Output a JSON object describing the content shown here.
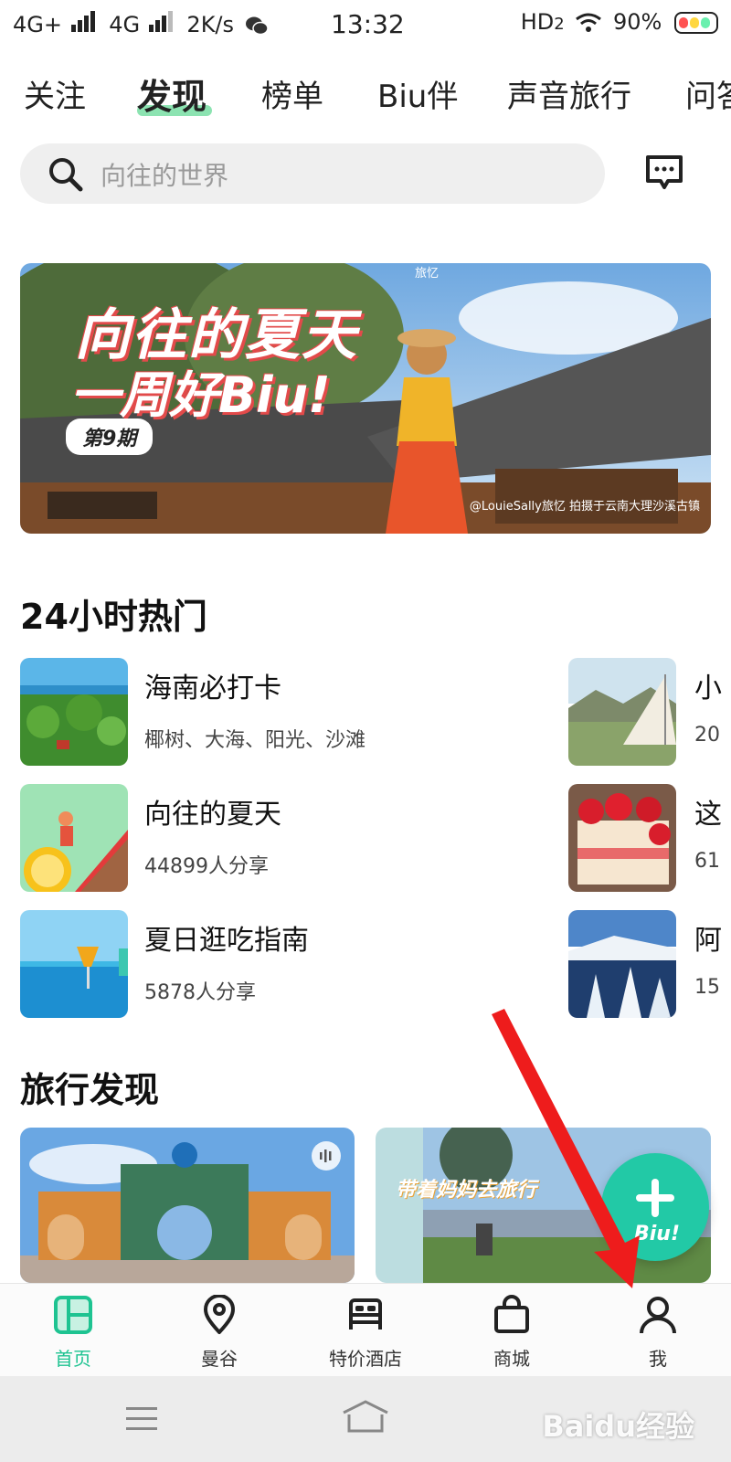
{
  "status_bar": {
    "network1": "4G+",
    "network2": "4G",
    "speed": "2K/s",
    "time": "13:32",
    "hd": "HD",
    "hd_sub": "2",
    "battery": "90%"
  },
  "tabs": [
    "关注",
    "发现",
    "榜单",
    "Biu伴",
    "声音旅行",
    "问答"
  ],
  "active_tab": "发现",
  "search": {
    "placeholder": "向往的世界"
  },
  "banner": {
    "line1": "向往的夏天",
    "line2": "一周好Biu!",
    "issue": "第9期",
    "credit": "@LouieSally旅忆  拍摄于云南大理沙溪古镇",
    "watermark": "旅忆"
  },
  "hot_section": {
    "title": "24小时热门",
    "items": [
      {
        "title": "海南必打卡",
        "subtitle": "椰树、大海、阳光、沙滩"
      },
      {
        "title": "向往的夏天",
        "subtitle": "44899人分享"
      },
      {
        "title": "夏日逛吃指南",
        "subtitle": "5878人分享"
      },
      {
        "title": "小",
        "subtitle": "20"
      },
      {
        "title": "这",
        "subtitle": "61"
      },
      {
        "title": "阿",
        "subtitle": "15"
      }
    ]
  },
  "discover_section": {
    "title": "旅行发现",
    "card2_text": "带着妈妈去旅行"
  },
  "fab": {
    "label": "Biu!"
  },
  "bottom_nav": [
    {
      "label": "首页",
      "icon": "home-grid-icon",
      "active": true
    },
    {
      "label": "曼谷",
      "icon": "location-pin-icon",
      "active": false
    },
    {
      "label": "特价酒店",
      "icon": "bed-icon",
      "active": false
    },
    {
      "label": "商城",
      "icon": "shopping-bag-icon",
      "active": false
    },
    {
      "label": "我",
      "icon": "person-icon",
      "active": false
    }
  ],
  "watermark": "Baidu经验",
  "colors": {
    "accent": "#1ec391",
    "fab": "#22c9a6",
    "arrow": "#ee1c1c"
  }
}
